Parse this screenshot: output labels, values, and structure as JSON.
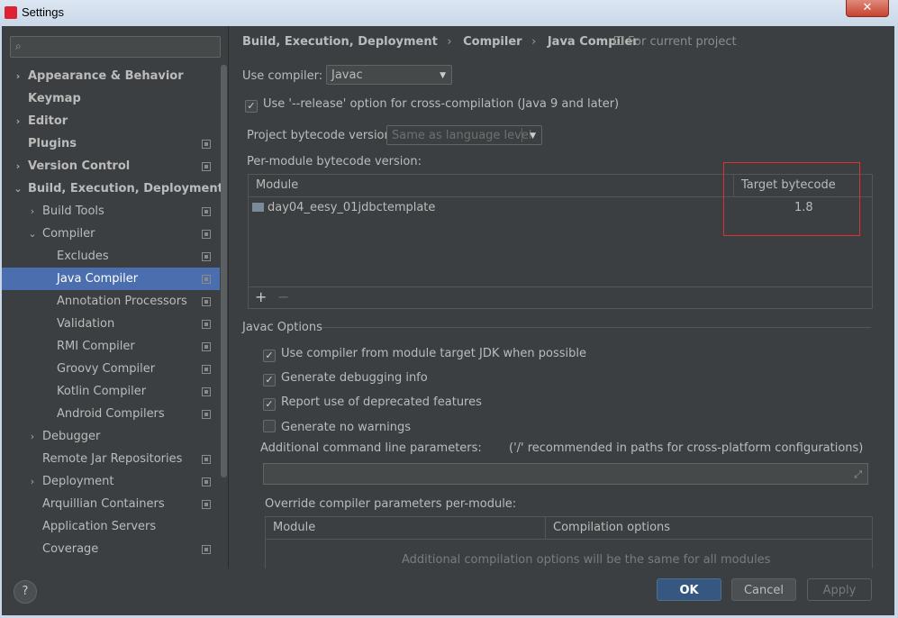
{
  "window": {
    "title": "Settings",
    "close_label": "✕"
  },
  "search": {
    "placeholder": "",
    "value": ""
  },
  "sidebar": {
    "items": [
      {
        "label": "Appearance & Behavior",
        "level": 0,
        "bold": true,
        "chevron": "›",
        "proj": false
      },
      {
        "label": "Keymap",
        "level": 0,
        "bold": true,
        "chevron": "",
        "proj": false
      },
      {
        "label": "Editor",
        "level": 0,
        "bold": true,
        "chevron": "›",
        "proj": false
      },
      {
        "label": "Plugins",
        "level": 0,
        "bold": true,
        "chevron": "",
        "proj": true
      },
      {
        "label": "Version Control",
        "level": 0,
        "bold": true,
        "chevron": "›",
        "proj": true
      },
      {
        "label": "Build, Execution, Deployment",
        "level": 0,
        "bold": true,
        "chevron": "⌄",
        "proj": false
      },
      {
        "label": "Build Tools",
        "level": 1,
        "bold": false,
        "chevron": "›",
        "proj": true
      },
      {
        "label": "Compiler",
        "level": 1,
        "bold": false,
        "chevron": "⌄",
        "proj": true
      },
      {
        "label": "Excludes",
        "level": 2,
        "bold": false,
        "chevron": "",
        "proj": true
      },
      {
        "label": "Java Compiler",
        "level": 2,
        "bold": false,
        "chevron": "",
        "proj": true,
        "selected": true
      },
      {
        "label": "Annotation Processors",
        "level": 2,
        "bold": false,
        "chevron": "",
        "proj": true
      },
      {
        "label": "Validation",
        "level": 2,
        "bold": false,
        "chevron": "",
        "proj": true
      },
      {
        "label": "RMI Compiler",
        "level": 2,
        "bold": false,
        "chevron": "",
        "proj": true
      },
      {
        "label": "Groovy Compiler",
        "level": 2,
        "bold": false,
        "chevron": "",
        "proj": true
      },
      {
        "label": "Kotlin Compiler",
        "level": 2,
        "bold": false,
        "chevron": "",
        "proj": true
      },
      {
        "label": "Android Compilers",
        "level": 2,
        "bold": false,
        "chevron": "",
        "proj": true
      },
      {
        "label": "Debugger",
        "level": 1,
        "bold": false,
        "chevron": "›",
        "proj": false
      },
      {
        "label": "Remote Jar Repositories",
        "level": 1,
        "bold": false,
        "chevron": "",
        "proj": true
      },
      {
        "label": "Deployment",
        "level": 1,
        "bold": false,
        "chevron": "›",
        "proj": true
      },
      {
        "label": "Arquillian Containers",
        "level": 1,
        "bold": false,
        "chevron": "",
        "proj": true
      },
      {
        "label": "Application Servers",
        "level": 1,
        "bold": false,
        "chevron": "",
        "proj": false
      },
      {
        "label": "Coverage",
        "level": 1,
        "bold": false,
        "chevron": "",
        "proj": true
      }
    ]
  },
  "breadcrumb": {
    "part1": "Build, Execution, Deployment",
    "part2": "Compiler",
    "part3": "Java Compiler",
    "sep": "›"
  },
  "for_project": "For current project",
  "use_compiler": {
    "label": "Use compiler:",
    "value": "Javac"
  },
  "release_option": {
    "checked": true,
    "label": "Use '--release' option for cross-compilation (Java 9 and later)"
  },
  "project_bytecode": {
    "label": "Project bytecode version:",
    "value": "Same as language level"
  },
  "per_module": {
    "label": "Per-module bytecode version:",
    "col_module": "Module",
    "col_target": "Target bytecode version",
    "rows": [
      {
        "module": "day04_eesy_01jdbctemplate",
        "target": "1.8"
      }
    ],
    "add_label": "+",
    "remove_label": "−"
  },
  "javac_options": {
    "title": "Javac Options",
    "options": [
      {
        "checked": true,
        "label": "Use compiler from module target JDK when possible"
      },
      {
        "checked": true,
        "label": "Generate debugging info"
      },
      {
        "checked": true,
        "label": "Report use of deprecated features"
      },
      {
        "checked": false,
        "label": "Generate no warnings"
      }
    ],
    "additional_label": "Additional command line parameters:",
    "additional_hint": "('/' recommended in paths for cross-platform configurations)",
    "additional_value": ""
  },
  "override": {
    "label": "Override compiler parameters per-module:",
    "col_module": "Module",
    "col_options": "Compilation options",
    "empty_text": "Additional compilation options will be the same for all modules"
  },
  "footer": {
    "help": "?",
    "ok": "OK",
    "cancel": "Cancel",
    "apply": "Apply"
  },
  "colors": {
    "selection": "#4b6eaf",
    "highlight_box": "#e03030",
    "primary_button": "#365880"
  }
}
